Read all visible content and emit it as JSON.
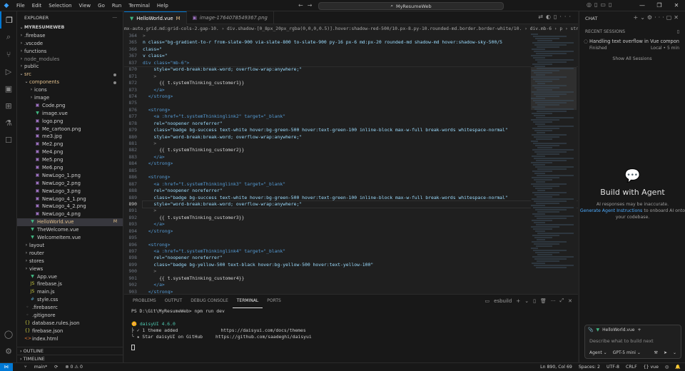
{
  "menu": [
    "File",
    "Edit",
    "Selection",
    "View",
    "Go",
    "Run",
    "Terminal",
    "Help"
  ],
  "command_center": "MyResumeWeb",
  "sidebar": {
    "title": "EXPLORER",
    "root": "MYRESUMEWEB",
    "items": [
      {
        "label": ".firebase",
        "type": "folder",
        "indent": 1,
        "chev": "›"
      },
      {
        "label": ".vscode",
        "type": "folder",
        "indent": 1,
        "chev": "›"
      },
      {
        "label": "functions",
        "type": "folder",
        "indent": 1,
        "chev": "›"
      },
      {
        "label": "node_modules",
        "type": "folder",
        "indent": 1,
        "chev": "›",
        "dim": true
      },
      {
        "label": "public",
        "type": "folder",
        "indent": 1,
        "chev": "›"
      },
      {
        "label": "src",
        "type": "folder",
        "indent": 1,
        "chev": "⌄",
        "mod": true,
        "dot": true
      },
      {
        "label": "components",
        "type": "folder",
        "indent": 2,
        "chev": "⌄",
        "mod": true,
        "dot": true
      },
      {
        "label": "icons",
        "type": "folder",
        "indent": 3,
        "chev": "›"
      },
      {
        "label": "image",
        "type": "folder",
        "indent": 3,
        "chev": "›"
      },
      {
        "label": "Code.png",
        "type": "png",
        "indent": 3
      },
      {
        "label": "image.vue",
        "type": "vue",
        "indent": 3
      },
      {
        "label": "logo.png",
        "type": "png",
        "indent": 3
      },
      {
        "label": "Me_cartoon.png",
        "type": "png",
        "indent": 3
      },
      {
        "label": "me3.jpg",
        "type": "png",
        "indent": 3
      },
      {
        "label": "Me2.png",
        "type": "png",
        "indent": 3
      },
      {
        "label": "Me4.png",
        "type": "png",
        "indent": 3
      },
      {
        "label": "Me5.png",
        "type": "png",
        "indent": 3
      },
      {
        "label": "Me6.png",
        "type": "png",
        "indent": 3
      },
      {
        "label": "NewLogo_1.png",
        "type": "png",
        "indent": 3
      },
      {
        "label": "NewLogo_2.png",
        "type": "png",
        "indent": 3
      },
      {
        "label": "NewLogo_3.png",
        "type": "png",
        "indent": 3
      },
      {
        "label": "NewLogo_4_1.png",
        "type": "png",
        "indent": 3
      },
      {
        "label": "NewLogo_4_2.png",
        "type": "png",
        "indent": 3
      },
      {
        "label": "NewLogo_4.png",
        "type": "png",
        "indent": 3
      },
      {
        "label": "HelloWorld.vue",
        "type": "vue",
        "indent": 2,
        "sel": true,
        "mod": true,
        "badge": "M"
      },
      {
        "label": "TheWelcome.vue",
        "type": "vue",
        "indent": 2
      },
      {
        "label": "WelcomeItem.vue",
        "type": "vue",
        "indent": 2
      },
      {
        "label": "layout",
        "type": "folder",
        "indent": 2,
        "chev": "›"
      },
      {
        "label": "router",
        "type": "folder",
        "indent": 2,
        "chev": "›"
      },
      {
        "label": "stores",
        "type": "folder",
        "indent": 2,
        "chev": "›"
      },
      {
        "label": "views",
        "type": "folder",
        "indent": 2,
        "chev": "›"
      },
      {
        "label": "App.vue",
        "type": "vue",
        "indent": 2
      },
      {
        "label": "firebase.js",
        "type": "js",
        "indent": 2
      },
      {
        "label": "main.js",
        "type": "js",
        "indent": 2
      },
      {
        "label": "style.css",
        "type": "css",
        "indent": 2
      },
      {
        "label": ".firebaserc",
        "type": "cfg",
        "indent": 1
      },
      {
        "label": ".gitignore",
        "type": "cfg",
        "indent": 1
      },
      {
        "label": "database.rules.json",
        "type": "json",
        "indent": 1
      },
      {
        "label": "firebase.json",
        "type": "json",
        "indent": 1
      },
      {
        "label": "index.html",
        "type": "html",
        "indent": 1
      }
    ],
    "outline": "OUTLINE",
    "timeline": "TIMELINE"
  },
  "tabs": [
    {
      "label": "HelloWorld.vue",
      "modified": "M",
      "active": true
    },
    {
      "label": "image-1764078549367.png",
      "active": false
    }
  ],
  "breadcrumbs": "mx-auto.grid.md:grid-cols-2.gap-10. › div.shadow-[0_8px_20px_rgba(0,0,0,0.5)].hover:shadow-red-500/10.px-8.py-10.rounded-md.border.border-white/10. › div.mb-6 › p › strong › a.badge.bg-success.te",
  "code_lines": [
    {
      "n": "364",
      "t": ">"
    },
    {
      "n": "365",
      "t": "n class=\"bg-gradient-to-r from-slate-900 via-slate-800 to-slate-900 py-16 px-6 md:px-20 rounded-md shadow-md hover:shadow-sky-500/5"
    },
    {
      "n": "366",
      "t": "class=\""
    },
    {
      "n": "367",
      "t": "v class=\""
    },
    {
      "n": "837",
      "t": "div class=\"mb-6\">"
    },
    {
      "n": "870",
      "t": "    style=\"word-break:break-word; overflow-wrap:anywhere;\""
    },
    {
      "n": "871",
      "t": "    >"
    },
    {
      "n": "872",
      "t": "      {{ t.systemThinking_customer1}}"
    },
    {
      "n": "873",
      "t": "    </a>"
    },
    {
      "n": "874",
      "t": "  </strong>"
    },
    {
      "n": "875",
      "t": ""
    },
    {
      "n": "876",
      "t": "  <strong>"
    },
    {
      "n": "877",
      "t": "    <a :href=\"t.systemThinkinglink2\" target=\"_blank\""
    },
    {
      "n": "878",
      "t": "    rel=\"noopener noreferrer\""
    },
    {
      "n": "879",
      "t": "    class=\"badge bg-success text-white hover:bg-green-500 hover:text-green-100 inline-block max-w-full break-words whitespace-normal\""
    },
    {
      "n": "880",
      "t": "    style=\"word-break:break-word; overflow-wrap:anywhere;\""
    },
    {
      "n": "881",
      "t": "    >"
    },
    {
      "n": "882",
      "t": "      {{ t.systemThinking_customer2}}"
    },
    {
      "n": "883",
      "t": "    </a>"
    },
    {
      "n": "884",
      "t": "  </strong>"
    },
    {
      "n": "885",
      "t": ""
    },
    {
      "n": "886",
      "t": "  <strong>"
    },
    {
      "n": "887",
      "t": "    <a :href=\"t.systemThinkinglink3\" target=\"_blank\""
    },
    {
      "n": "888",
      "t": "    rel=\"noopener noreferrer\""
    },
    {
      "n": "889",
      "t": "    class=\"badge bg-success text-white hover:bg-green-500 hover:text-green-100 inline-block max-w-full break-words whitespace-normal\""
    },
    {
      "n": "890",
      "t": "    style=\"word-break:break-word; overflow-wrap:anywhere;\"",
      "current": true
    },
    {
      "n": "891",
      "t": "    >"
    },
    {
      "n": "892",
      "t": "      {{ t.systemThinking_customer3}}"
    },
    {
      "n": "893",
      "t": "    </a>"
    },
    {
      "n": "894",
      "t": "  </strong>"
    },
    {
      "n": "895",
      "t": ""
    },
    {
      "n": "896",
      "t": "  <strong>"
    },
    {
      "n": "897",
      "t": "    <a :href=\"t.systemThinkinglink4\" target=\"_blank\""
    },
    {
      "n": "898",
      "t": "    rel=\"noopener noreferrer\""
    },
    {
      "n": "899",
      "t": "    class=\"badge bg-yellow-500 text-black hover:bg-yellow-500 hover:text-yellow-100\""
    },
    {
      "n": "900",
      "t": "    >"
    },
    {
      "n": "901",
      "t": "      {{ t.systemThinking_customer4}}"
    },
    {
      "n": "902",
      "t": "    </a>"
    },
    {
      "n": "903",
      "t": "  </strong>"
    }
  ],
  "panel": {
    "tabs": [
      "PROBLEMS",
      "OUTPUT",
      "DEBUG CONSOLE",
      "TERMINAL",
      "PORTS"
    ],
    "active_tab": "TERMINAL",
    "terminal_name": "esbuild",
    "prompt": "PS D:\\Git\\MyResumeWeb> npm run dev",
    "daisy_title": "daisyUI 4.6.0",
    "daisy_line1": "├ ✓ 1 theme added",
    "daisy_line1_url": "https://daisyui.com/docs/themes",
    "daisy_line2": "╰ ★ Star daisyUI on GitHub",
    "daisy_line2_url": "https://github.com/saadeghi/daisyui"
  },
  "chat": {
    "title": "CHAT",
    "recent": "RECENT SESSIONS",
    "session_title": "Handling text overflow in Vue component ...",
    "session_status": "Finished",
    "session_meta": "Local • 5 min",
    "show_all": "Show All Sessions",
    "agent_title": "Build with Agent",
    "agent_note": "AI responses may be inaccurate.",
    "agent_link": "Generate Agent Instructions",
    "agent_tail": "to onboard AI onto your codebase.",
    "chip": "HelloWorld.vue",
    "placeholder": "Describe what to build next",
    "mode": "Agent",
    "model": "GPT-5 mini"
  },
  "status": {
    "branch": "main*",
    "problems": "⊗ 0 ⚠ 0",
    "ln_col": "Ln 890, Col 69",
    "spaces": "Spaces: 2",
    "encoding": "UTF-8",
    "eol": "CRLF",
    "lang": "vue"
  },
  "colors": {
    "accent": "#0078d4",
    "modified": "#e2c08d",
    "vue": "#41b883",
    "png": "#a074c4"
  }
}
